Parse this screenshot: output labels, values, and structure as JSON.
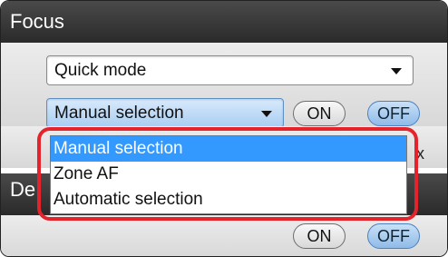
{
  "focus_section": {
    "title": "Focus"
  },
  "mode_select": {
    "value": "Quick mode"
  },
  "af_select": {
    "value": "Manual selection"
  },
  "toggle_row1": {
    "on_label": "ON",
    "off_label": "OFF"
  },
  "af_dropdown": {
    "options": [
      {
        "label": "Manual selection",
        "selected": true
      },
      {
        "label": "Zone AF",
        "selected": false
      },
      {
        "label": "Automatic selection",
        "selected": false
      }
    ]
  },
  "lower_section": {
    "title_visible": "De"
  },
  "toggle_row2": {
    "on_label": "ON",
    "off_label": "OFF"
  },
  "partial_glyph": "x",
  "colors": {
    "highlight_frame": "#e4232b",
    "selection": "#3399ff",
    "header": "#333333"
  }
}
